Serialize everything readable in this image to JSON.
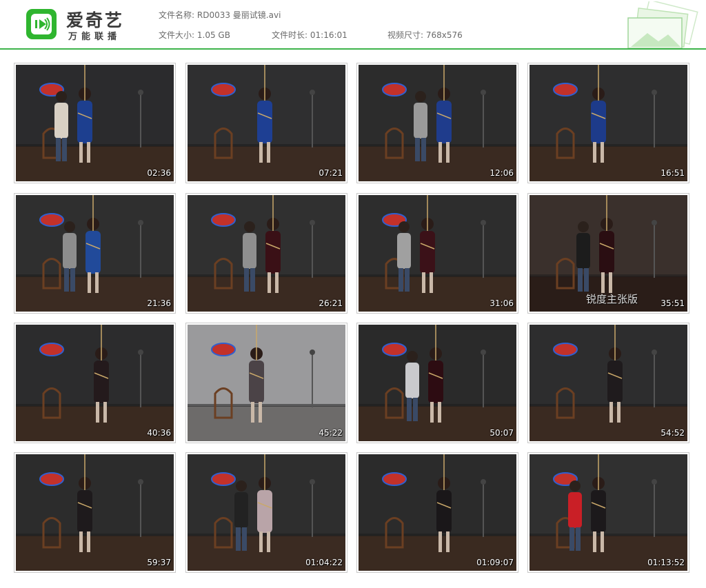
{
  "brand": {
    "title": "爱奇艺",
    "subtitle": "万能联播",
    "logo_icon": "iqiyi-tv-logo",
    "accent_color": "#3db34a"
  },
  "file_info": {
    "name_label": "文件名称:",
    "name_value": "RD0033 曼丽试镜.avi",
    "size_label": "文件大小:",
    "size_value": "1.05 GB",
    "duration_label": "文件时长:",
    "duration_value": "01:16:01",
    "dimensions_label": "视频尺寸:",
    "dimensions_value": "768x576"
  },
  "thumbnails": [
    {
      "timestamp": "02:36"
    },
    {
      "timestamp": "07:21"
    },
    {
      "timestamp": "12:06"
    },
    {
      "timestamp": "16:51"
    },
    {
      "timestamp": "21:36"
    },
    {
      "timestamp": "26:21"
    },
    {
      "timestamp": "31:06"
    },
    {
      "timestamp": "35:51",
      "watermark": "锐度主张版"
    },
    {
      "timestamp": "40:36"
    },
    {
      "timestamp": "45:22"
    },
    {
      "timestamp": "50:07"
    },
    {
      "timestamp": "54:52"
    },
    {
      "timestamp": "59:37"
    },
    {
      "timestamp": "01:04:22"
    },
    {
      "timestamp": "01:09:07"
    },
    {
      "timestamp": "01:13:52"
    }
  ]
}
